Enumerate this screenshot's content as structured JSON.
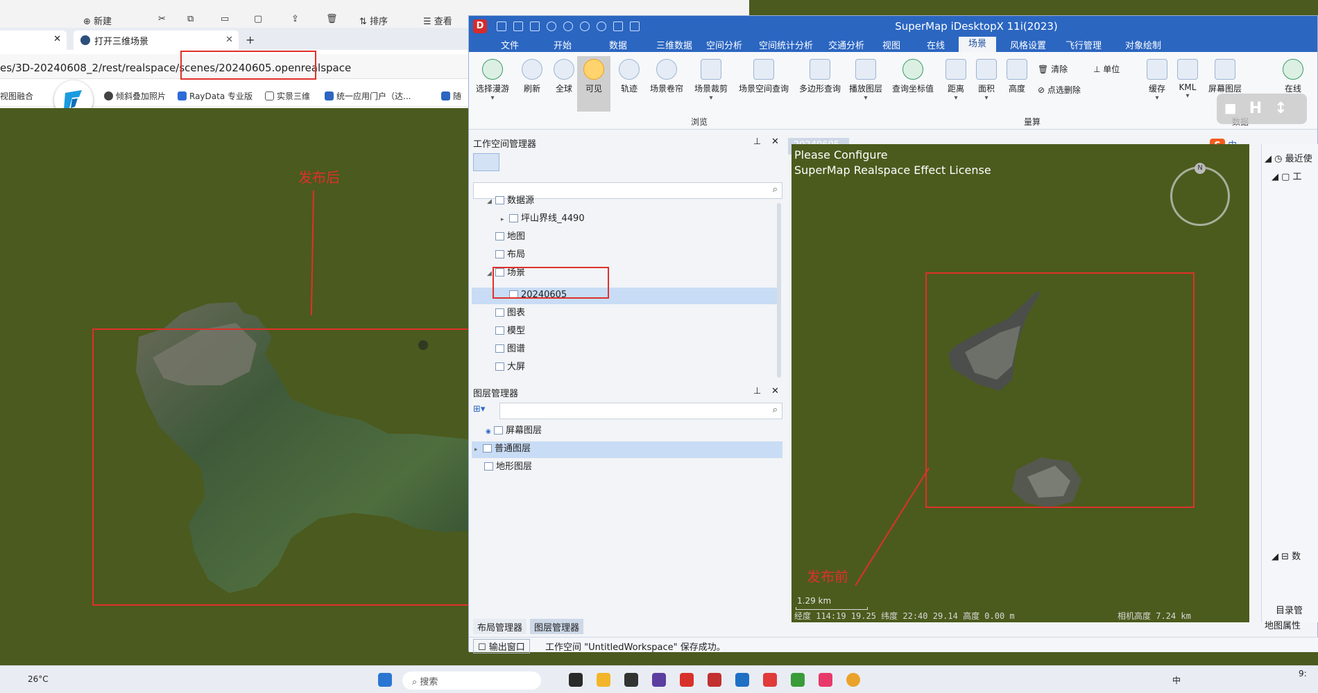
{
  "browser": {
    "top_strip": {
      "new_label": "新建",
      "sort_label": "排序",
      "view_label": "查看"
    },
    "tabs": [
      {
        "label": "打开三维场景",
        "active": true
      }
    ],
    "new_tab_label": "+",
    "address_url_prefix": "es/3D-20240608_2/rest/realspace/scenes/",
    "address_url_highlight": "20240605.openrealspace",
    "bookmarks": [
      {
        "label": "视图融合",
        "color": "#2b66c1"
      },
      {
        "label": "倾斜叠加照片",
        "color": "#444444"
      },
      {
        "label": "RayData 专业版",
        "color": "#2d6bd7"
      },
      {
        "label": "实景三维",
        "color": "#666666"
      },
      {
        "label": "统一应用门户（达...",
        "color": "#2b66c1"
      },
      {
        "label": "随",
        "color": "#2b66c1"
      }
    ],
    "annotation_after": "发布后"
  },
  "supermap": {
    "title": "SuperMap iDesktopX 11i(2023)",
    "menu": [
      "文件",
      "开始",
      "数据",
      "三维数据",
      "空间分析",
      "空间统计分析",
      "交通分析",
      "视图",
      "在线",
      "场景",
      "风格设置",
      "飞行管理",
      "对象绘制"
    ],
    "active_menu": "场景",
    "ribbon_buttons": [
      {
        "label": "选择漫游",
        "icon": "cursor-icon"
      },
      {
        "label": "刷新",
        "icon": "refresh-icon"
      },
      {
        "label": "全球",
        "icon": "globe-icon"
      },
      {
        "label": "可见",
        "icon": "sun-icon"
      },
      {
        "label": "轨迹",
        "icon": "track-icon"
      },
      {
        "label": "场景卷帘",
        "icon": "swipe-icon"
      },
      {
        "label": "场景裁剪",
        "icon": "clip-icon"
      },
      {
        "label": "场景空间查询",
        "icon": "cube-query-icon"
      },
      {
        "label": "多边形查询",
        "icon": "polygon-query-icon"
      },
      {
        "label": "播放图层",
        "icon": "play-layer-icon"
      },
      {
        "label": "查询坐标值",
        "icon": "coordinate-icon"
      },
      {
        "label": "距离",
        "icon": "ruler-icon"
      },
      {
        "label": "面积",
        "icon": "area-icon"
      },
      {
        "label": "高度",
        "icon": "height-icon"
      }
    ],
    "ribbon_small": {
      "clear": "清除",
      "point_delete": "点选删除",
      "unit": "单位"
    },
    "ribbon_right": [
      {
        "label": "缓存"
      },
      {
        "label": "KML"
      },
      {
        "label": "屏幕图层"
      },
      {
        "label": "在线"
      }
    ],
    "groups": {
      "browse": "浏览",
      "measure": "量算",
      "data": "数据"
    },
    "workspace_panel": {
      "title": "工作空间管理器",
      "tree": [
        {
          "label": "数据源",
          "level": 1,
          "expanded": true
        },
        {
          "label": "坪山界线_4490",
          "level": 2,
          "expanded": false
        },
        {
          "label": "地图",
          "level": 1
        },
        {
          "label": "布局",
          "level": 1
        },
        {
          "label": "场景",
          "level": 1,
          "expanded": true
        },
        {
          "label": "20240605",
          "level": 2,
          "selected": true
        },
        {
          "label": "图表",
          "level": 1
        },
        {
          "label": "模型",
          "level": 1
        },
        {
          "label": "图谱",
          "level": 1
        },
        {
          "label": "大屏",
          "level": 1
        }
      ]
    },
    "layer_panel": {
      "title": "图层管理器",
      "layers": [
        {
          "label": "屏幕图层",
          "visible": true
        },
        {
          "label": "普通图层",
          "selected": true
        },
        {
          "label": "地形图层"
        }
      ]
    },
    "bottom_tabs": [
      "布局管理器",
      "图层管理器"
    ],
    "output_button": "输出窗口",
    "status_message": "工作空间 \"UntitledWorkspace\" 保存成功。",
    "scene_tab": "20240605",
    "license_line1": "Please Configure",
    "license_line2": "SuperMap Realspace Effect License",
    "annotation_before": "发布前",
    "scale_label": "1.29 km",
    "coords": "经度 114:19  19.25  纬度 22:40  29.14  高度 0.00 m",
    "camera_height": "相机高度 7.24 km",
    "compass_label": "N",
    "right_panel_labels": {
      "recent": "最近使",
      "work": "工",
      "data": "数",
      "catalog": "目录管",
      "map_props": "地图属性"
    },
    "ime_chinese": "中"
  },
  "taskbar": {
    "weather": "26°C",
    "search": "搜索",
    "lang": "中",
    "time": "9:"
  }
}
